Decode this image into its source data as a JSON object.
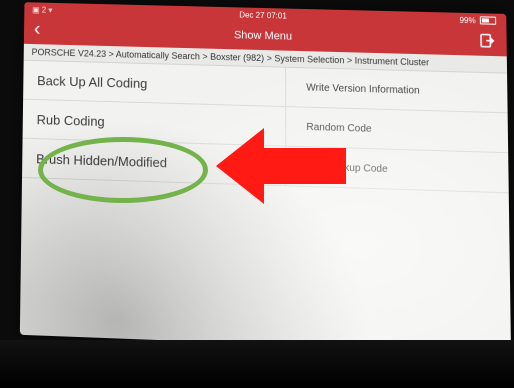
{
  "status": {
    "left_icons": "▣ 2 ▾",
    "clock": "Dec 27 07:01",
    "battery_label": "99%"
  },
  "header": {
    "title": "Show Menu",
    "back_icon": "chevron-left-icon",
    "exit_icon": "exit-icon"
  },
  "breadcrumb": "PORSCHE V24.23 > Automatically Search > Boxster (982) > System Selection > Instrument Cluster",
  "menu": {
    "left": [
      "Back Up All Coding",
      "Rub Coding",
      "Brush Hidden/Modified"
    ],
    "right": [
      "Write Version Information",
      "Random Code",
      "The Backup Code"
    ]
  },
  "colors": {
    "header": "#c8363a",
    "annotation_circle": "#74b24b",
    "annotation_arrow": "#ff1a14"
  }
}
